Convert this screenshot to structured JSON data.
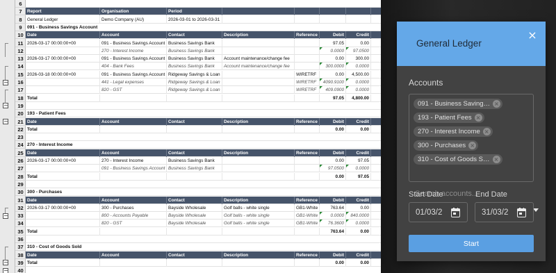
{
  "sheet": {
    "first_row_number": 6,
    "rows": [
      {
        "type": "blank"
      },
      {
        "type": "hdr",
        "cells": [
          "Report",
          "Organisation",
          "Period",
          "",
          "",
          "",
          ""
        ]
      },
      {
        "type": "data",
        "cells": [
          "General Ledger",
          "Demo Company (AU)",
          "2026-03-01 to 2026-03-31",
          "",
          "",
          "",
          ""
        ]
      },
      {
        "type": "section",
        "text": "091 - Business Savings Account"
      },
      {
        "type": "hdr",
        "cells": [
          "Date",
          "Account",
          "Contact",
          "Description",
          "Reference",
          "Debit",
          "Credit"
        ]
      },
      {
        "type": "data",
        "cells": [
          "2026-03-17 00:00:00+00",
          "091 - Business Savings Account",
          "Business Savings Bank",
          "",
          "",
          "97.05",
          "0.00"
        ]
      },
      {
        "type": "line",
        "cells": [
          "",
          "270 - Interest Income",
          "Business Savings Bank",
          "",
          "",
          "0.0000",
          "97.0500"
        ]
      },
      {
        "type": "data",
        "cells": [
          "2026-03-17 00:00:00+00",
          "091 - Business Savings Account",
          "Business Savings Bank",
          "Account maintenance/change fee",
          "",
          "0.00",
          "300.00"
        ]
      },
      {
        "type": "line",
        "cells": [
          "",
          "404 - Bank Fees",
          "Business Savings Bank",
          "Account maintenance/change fee",
          "",
          "300.0000",
          "0.0000"
        ]
      },
      {
        "type": "data",
        "cells": [
          "2026-03-18 00:00:00+00",
          "091 - Business Savings Account",
          "Ridgeway Savings & Loan",
          "",
          "WIRETRF",
          "0.00",
          "4,500.00"
        ]
      },
      {
        "type": "line",
        "cells": [
          "",
          "441 - Legal expenses",
          "Ridgeway Savings & Loan",
          "",
          "WIRETRF",
          "4090.9100",
          "0.0000"
        ]
      },
      {
        "type": "line",
        "cells": [
          "",
          "820 - GST",
          "Ridgeway Savings & Loan",
          "",
          "WIRETRF",
          "409.0900",
          "0.0000"
        ]
      },
      {
        "type": "total",
        "cells": [
          "Total",
          "",
          "",
          "",
          "",
          "97.05",
          "4,800.00"
        ]
      },
      {
        "type": "blank"
      },
      {
        "type": "section",
        "text": "193 - Patient Fees"
      },
      {
        "type": "hdr",
        "cells": [
          "Date",
          "Account",
          "Contact",
          "Description",
          "Reference",
          "Debit",
          "Credit"
        ]
      },
      {
        "type": "total",
        "cells": [
          "Total",
          "",
          "",
          "",
          "",
          "0.00",
          "0.00"
        ]
      },
      {
        "type": "blank"
      },
      {
        "type": "section",
        "text": "270 - Interest Income"
      },
      {
        "type": "hdr",
        "cells": [
          "Date",
          "Account",
          "Contact",
          "Description",
          "Reference",
          "Debit",
          "Credit"
        ]
      },
      {
        "type": "data",
        "cells": [
          "2026-03-17 00:00:00+00",
          "270 - Interest Income",
          "Business Savings Bank",
          "",
          "",
          "0.00",
          "97.05"
        ]
      },
      {
        "type": "line",
        "cells": [
          "",
          "091 - Business Savings Account",
          "Business Savings Bank",
          "",
          "",
          "97.0500",
          "0.0000"
        ]
      },
      {
        "type": "total",
        "cells": [
          "Total",
          "",
          "",
          "",
          "",
          "0.00",
          "97.05"
        ]
      },
      {
        "type": "blank"
      },
      {
        "type": "section",
        "text": "300 - Purchases"
      },
      {
        "type": "hdr",
        "cells": [
          "Date",
          "Account",
          "Contact",
          "Description",
          "Reference",
          "Debit",
          "Credit"
        ]
      },
      {
        "type": "data",
        "cells": [
          "2026-03-17 00:00:00+00",
          "300 - Purchases",
          "Bayside Wholesale",
          "Golf balls - white single",
          "GB1-White",
          "763.64",
          "0.00"
        ]
      },
      {
        "type": "line",
        "cells": [
          "",
          "800 - Accounts Payable",
          "Bayside Wholesale",
          "Golf balls - white single",
          "GB1-White",
          "0.0000",
          "840.0000"
        ]
      },
      {
        "type": "line",
        "cells": [
          "",
          "820 - GST",
          "Bayside Wholesale",
          "Golf balls - white single",
          "GB1-White",
          "76.3600",
          "0.0000"
        ]
      },
      {
        "type": "total",
        "cells": [
          "Total",
          "",
          "",
          "",
          "",
          "763.64",
          "0.00"
        ]
      },
      {
        "type": "blank"
      },
      {
        "type": "section",
        "text": "310 - Cost of Goods Sold"
      },
      {
        "type": "hdr",
        "cells": [
          "Date",
          "Account",
          "Contact",
          "Description",
          "Reference",
          "Debit",
          "Credit"
        ]
      },
      {
        "type": "total",
        "cells": [
          "Total",
          "",
          "",
          "",
          "",
          "0.00",
          "0.00"
        ]
      },
      {
        "type": "blank"
      }
    ]
  },
  "panel": {
    "title": "General Ledger",
    "close_icon": "×",
    "accounts_label": "Accounts",
    "accounts_selected": [
      "091 - Business Saving…",
      "193 - Patient Fees",
      "270 - Interest Income",
      "300 - Purchases",
      "310 - Cost of Goods S…"
    ],
    "search_placeholder": "Search accounts...",
    "start_date_label": "Start Date",
    "start_date_value": "01/03/2",
    "end_date_label": "End Date",
    "end_date_value": "31/03/2",
    "start_button": "Start"
  },
  "colors": {
    "panel_header": "#64a8e8",
    "start_button": "#5a9fe2",
    "sheet_header_row": "#46546a"
  }
}
